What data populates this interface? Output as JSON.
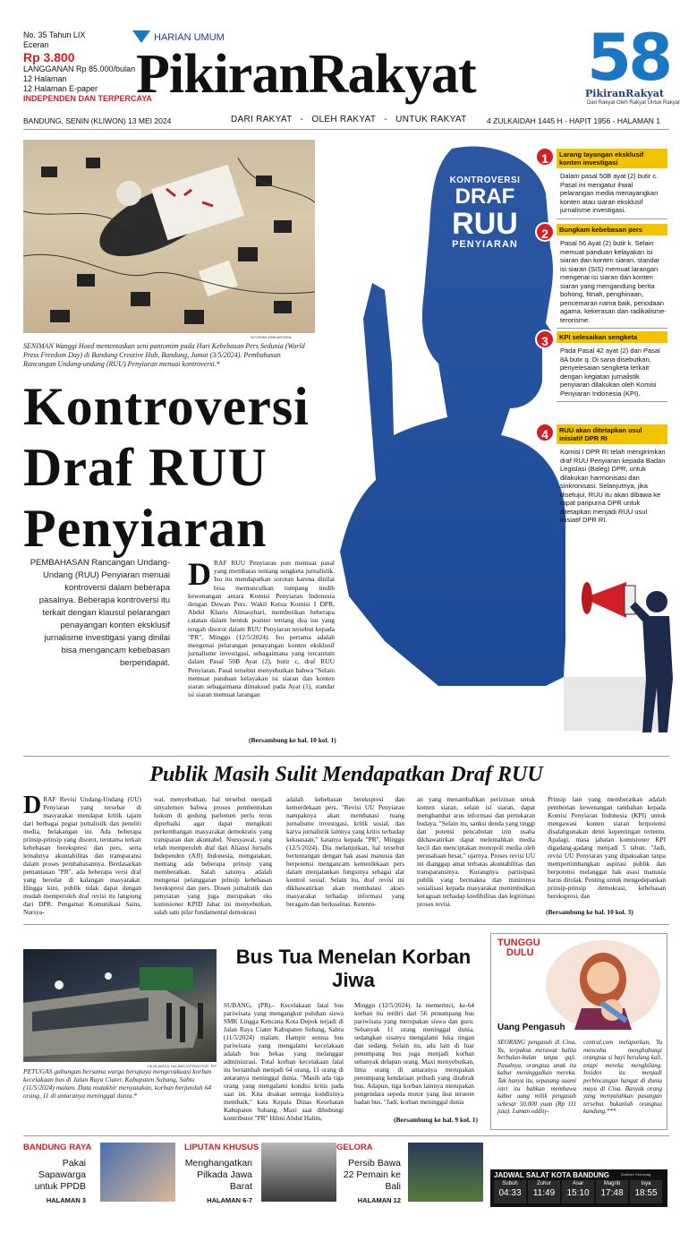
{
  "masthead": {
    "issue_no": "No. 35 Tahun LIX",
    "retail_label": "Eceran",
    "price": "Rp 3.800",
    "subscription": "LANGGANAN Rp 85.000/bulan",
    "pages": "12 Halaman",
    "epaper": "12 Halaman E-paper",
    "independent": "INDEPENDEN DAN TERPERCAYA",
    "harian": "HARIAN UMUM",
    "logo": "PikiranRakyat",
    "anniv_number": "58",
    "anniv_logo": "PikiranRakyat",
    "anniv_tagline": "Dari Rakyat Oleh Rakyat Untuk Rakyat",
    "dateline": "BANDUNG, SENIN (KLIWON) 13 MEI 2024",
    "motto": "DARI RAKYAT   -   OLEH RAKYAT   -   UNTUK RAKYAT",
    "hijri": "4 ZULKAIDAH 1445 H - HAPIT 1956 - HALAMAN 1",
    "brand_red": "#d21f26",
    "brand_blue": "#1b76c4"
  },
  "main": {
    "photo_credit": "NOVRIAN ARBI/ANTARA",
    "caption": "SENIMAN Wanggi Hoed mementaskan seni pantomim pada Hari Kebebasan Pers Sedunia (World Press Freedom Day) di Bandung Creative Hub, Bandung, Jumat (3/5/2024). Pembahasan Rancangan Undang-undang (RUU) Penyiaran menuai kontroversi.*",
    "headline_1": "Kontroversi",
    "headline_2": "Draf RUU",
    "headline_3": "Penyiaran",
    "graphic_title_1": "KONTROVERSI",
    "graphic_title_2": "DRAF",
    "graphic_title_3": "RUU",
    "graphic_title_4": "PENYIARAN",
    "lead": "PEMBAHASAN Rancangan Undang-Undang (RUU) Penyiaran menuai kontroversi dalam beberapa pasalnya. Beberapa kontroversi itu terkait dengan klausul pelarangan penayangan konten eksklusif jurnalisme investigasi yang dinilai bisa mengancam kebebasan berpendapat.",
    "dropcap": "D",
    "body": "RAF RUU Penyiaran pun memuat pasal yang membatas tentang sengketa jurnalistik. Isu itu mendapatkan sorotan karena dinilai bisa memunculkan tumpang tindih kewenangan antara Komisi Penyiaran Indonesia dengan Dewan Pers. Wakil Ketua Komisi I DPR, Abdul Kharis Almasyhari, memberikan beberapa catatan dalam bentuk pointer tentang dua isu yang tengah disorot dalam RUU Penyiaran tersebut kepada \"PR\", Minggu (12/5/2024). Isu pertama adalah mengenai pelarangan penayangan konten eksklusif jurnalisme investigasi, sebagaimana yang tercantum dalam Pasal 50B Ayat (2), butir c, draf RUU Penyiaran. Pasal tersebut menyebutkan bahwa \"Selain memuat panduan kelayakan isi siaran dan konten siaran sebagaimana dimaksud pada Ayat (1), standar isi siaran memuat larangan",
    "continued": "(Bersambung ke hal. 10 kol. 1)"
  },
  "points": [
    {
      "num": "1",
      "tag": "Larang tayangan eksklusif konten investigasi",
      "text": "Dalam pasal 50B ayat (2) butir c. Pasal ini mengatur ihwal pelarangan media menayangkan konten atau siaran eksklusif jurnalisme investigasi."
    },
    {
      "num": "2",
      "tag": "Bungkam kebebasan pers",
      "text": "Pasal 56 Ayat (2) butir k. Selain memuat panduan kelayakan isi siaran dan konten siaran, standar isi siaran (SIS) memuat larangan mengenai isi siaran dan konten siaran yang mengandung berita bohong, fitnah, penghinaan, pencemaran nama baik, penodaan agama, kekerasan dan radikalisme-terorisme."
    },
    {
      "num": "3",
      "tag": "KPI selesaikan sengketa",
      "text": "Pada Pasal 42 ayat (2) dan Pasal 8A butir q. Di sana disebutkan, penyelesaian sengketa terkait dengan kegiatan jurnalistik penyiaran dilakukan oleh Komisi Penyiaran Indonesia (KPI)."
    },
    {
      "num": "4",
      "tag": "RUU akan ditetapkan usul inisiatif DPR RI",
      "text": "Komisi I DPR RI telah mengirimkan draf RUU Penyiaran kepada Badan Legislasi (Baleg) DPR, untuk dilakukan harmonisasi dan sinkronisasi. Selanjutnya, jika disetujui, RUU itu akan dibawa ke rapat paripurna DPR untuk ditetapkan menjadi RUU usul inisiatif DPR RI."
    }
  ],
  "second": {
    "headline": "Publik Masih Sulit Mendapatkan Draf RUU",
    "dropcap": "D",
    "col1": "RAF Revisi Undang-Undang (UU) Penyiaran yang tersebar di masyarakat mendapat kritik tajam dari berbagai pegiat jurnalistik dan peneliti media, belakangan ini. Ada beberapa prinsip-prinsip yang disorot, terutama terkait kebebasan berekspresi dan pers, serta lemahnya akuntabilitas dan transparansi dalam proses pembahasannya. Berdasarkan pemantauan \"PR\", ada beberapa versi draf yang beredar di kalangan masyarakat. Hingga kini, publik tidak dapat dengan mudah memperoleh draf revisi itu langsung dari DPR. Pengamat Komunikasi Sains, Nursya-",
    "col2": "wal, menyebutkan, hal tersebut menjadi sinyalemen bahwa proses pembentukan hukum di gedung parlemen perlu terus diperbaiki agar dapat mengikuti perkembangan masyarakat demokratis yang transparan dan akuntabel. Nursyawal, yang telah memperoleh draf dari Aliansi Jurnalis Independen (AJI) Indonesia, mengatakan, memang ada beberapa prinsip yang memberatkan. Salah satunya adalah mengenai pelanggaran prinsip kebebasan berekspresi dan pers. Dosen jurnalistik dan penyiaran yang juga merupakan eks komisioner KPID Jabar ini menyebutkan, salah satu pilar fundamental demokrasi",
    "col3": "adalah kebebasan berekspresi dan kemerdekaan pers. \"Revisi UU Penyiaran nampaknya akan membatasi ruang jurnalisme investigasi, kritik sosial, dan karya jurnalistik lainnya yang kritis terhadap kekuasaan,\" katanya kepada \"PR\", Minggu (12/5/2024). Dia melanjutkan, hal tersebut bertentangan dengan hak asasi manusia dan berpotensi mengancam kemerdekaan pers dalam menjalankan fungsinya sebagai alat kontrol sosial. Selain itu, draf revisi ini dikhawatirkan akan membatasi akses masyarakat terhadap informasi yang beragam dan berkualitas. Ketentu-",
    "col4": "an yang menambahkan perizinan untuk konten siaran, selain isi siaran, dapat menghambat arus informasi dan pertukaran budaya. \"Selain itu, sanksi denda yang tinggi dan potensi pencabutan izin usaha dikhawatirkan dapat melemahkan media kecil dan menciptakan monopoli media oleh perusahaan besar,\" ujarnya. Proses revisi UU ini dianggap amat terbatas akuntabilitas dan transparansinya. Kurangnya partisipasi publik yang bermakna dan minimnya sosialisasi kepada masyarakat menimbulkan keraguan terhadap kredibilitas dan legitimasi proses revisi.",
    "col5": "Prinsip lain yang memberatkan adalah pemberian kewenangan tambahan kepada Komisi Penyiaran Indonesia (KPI) untuk mengawasi konten siaran berpotensi disalahgunakan demi kepentingan tertentu. Apalagi, masa jabatan komisioner KPI digadang-gadang menjadi 5 tahun. \"Jadi, revisi UU Penyiaran yang dipaksakan tanpa mempertimbangkan aspirasi publik dan berpotensi melanggar hak asasi manusia harus ditolak. Penting untuk mengedepankan prinsip-prinsip demokrasi, kebebasan berekspresi, dan",
    "continued": "(Bersambung ke hal. 10 kol. 3)"
  },
  "bus": {
    "photo_credit": "HILMI ABDUL HALIM/KONTRIBUTOR \"PR\"",
    "caption": "PETUGAS gabungan bersama warga berupaya mengevakuasi korban kecelakaan bus di Jalan Raya Ciater, Kabupaten Subang, Sabtu (11/5/2024) malam. Data mutakhir menyatakan, korban berjumlah 64 orang, 11 di antaranya meninggal dunia.*",
    "headline": "Bus Tua Menelan Korban Jiwa",
    "col1": "SUBANG, (PR).- Kecelakaan fatal bus pariwisata yang mengangkut puluhan siswa SMK Lingga Kencana Kota Depok terjadi di Jalan Raya Ciater Kabupaten Subang, Sabtu (11/5/2024) malam. Hampir semua bus pariwisata yang mengalami kecelakaan adalah bus bekas yang melanggar administrasi. Total korban kecelakaan fatal itu bertambah menjadi 64 orang, 11 orang di antaranya meninggal dunia. \"Masih ada tiga orang yang mengalami kondisi kritis pada saat ini. Kita doakan semoga kondisinya membaik,\" kata Kepala Dinas Kesehatan Kabupaten Subang, Maxi saat dihubungi kontributor \"PR\" Hilmi Abdul Halim,",
    "col2": "Minggu (12/5/2024). Ia memerinci, ke-64 korban itu terdiri dari 56 penumpang bus pariwisata yang merupakan siswa dan guru. Sebanyak 11 orang meninggal dunia, sedangkan sisanya mengalami luka ringan dan sedang. Selain itu, ada lain di luar penumpang bus juga menjadi korban sebanyak delapan orang. Maxi menyebutkan, lima orang di antaranya merupakan penumpang kendaraan pribadi yang ditabrak bus. Adapun, tiga korban lainnya merupakan pengendara sepeda motor yang ikut terseret badan bus. \"Jadi, korban meninggal dunia",
    "continued": "(Bersambung ke hal. 9 kol. 1)"
  },
  "tunggu": {
    "logo_1": "TUNGGU",
    "logo_2": "DULU",
    "title": "Uang Pengasuh",
    "col1": "SEORANG pengasuh di Cina, Yu, terpaksa merawat balita berbulan-bulan tanpa gaji. Pasalnya, orangtua anak itu kabur meninggalkan mereka. Tak hanya itu, sepasang suami istri itu bahkan membawa kabur uang milik pengasuh sebesar 50.000 yuan (Rp 111 juta). Laman oddity-",
    "col2": "central.com melaporkan, Yu mencoba menghubungi orangtua si bayi berulang kali, tetapi mereka menghilang. Insiden itu menjadi perbincangan hangat di dunia maya di Cina. Banyak orang yang menyalahkan pasangan tersebut bukanlah orangtua kandung.***"
  },
  "teasers": [
    {
      "category": "BANDUNG RAYA",
      "title": "Pakai Sapawarga untuk PPDB",
      "page": "HALAMAN 3"
    },
    {
      "category": "LIPUTAN KHUSUS",
      "title": "Menghangatkan Pilkada Jawa Barat",
      "page": "HALAMAN 6-7"
    },
    {
      "category": "GELORA",
      "title": "Persib Bawa 22 Pemain ke Bali",
      "page": "HALAMAN 12"
    }
  ],
  "prayer": {
    "title": "JADWAL SALAT KOTA BANDUNG",
    "source": "Sumber: Kemenag",
    "times": [
      {
        "name": "Subuh",
        "time": "04:33"
      },
      {
        "name": "Zuhur",
        "time": "11:49"
      },
      {
        "name": "Asar",
        "time": "15:10"
      },
      {
        "name": "Magrib",
        "time": "17:48"
      },
      {
        "name": "Isya",
        "time": "18:55"
      }
    ]
  }
}
